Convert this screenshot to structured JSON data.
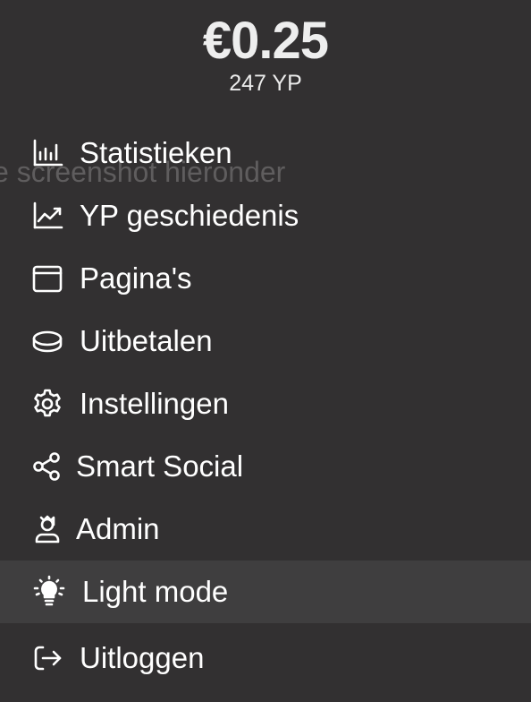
{
  "header": {
    "balance": "€0.25",
    "points": "247 YP"
  },
  "background_hint": "e screenshot hieronder",
  "menu": {
    "items": [
      {
        "label": "Statistieken",
        "icon": "bar-chart-icon"
      },
      {
        "label": "YP geschiedenis",
        "icon": "trend-chart-icon"
      },
      {
        "label": "Pagina's",
        "icon": "browser-window-icon"
      },
      {
        "label": "Uitbetalen",
        "icon": "coin-icon"
      },
      {
        "label": "Instellingen",
        "icon": "gear-icon"
      },
      {
        "label": "Smart Social",
        "icon": "share-icon"
      },
      {
        "label": "Admin",
        "icon": "admin-user-icon"
      },
      {
        "label": "Light mode",
        "icon": "lightbulb-icon",
        "active": true
      },
      {
        "label": "Uitloggen",
        "icon": "logout-icon"
      }
    ]
  },
  "colors": {
    "background": "#323031",
    "active_item": "#3f3e3f",
    "text": "#ffffff"
  }
}
